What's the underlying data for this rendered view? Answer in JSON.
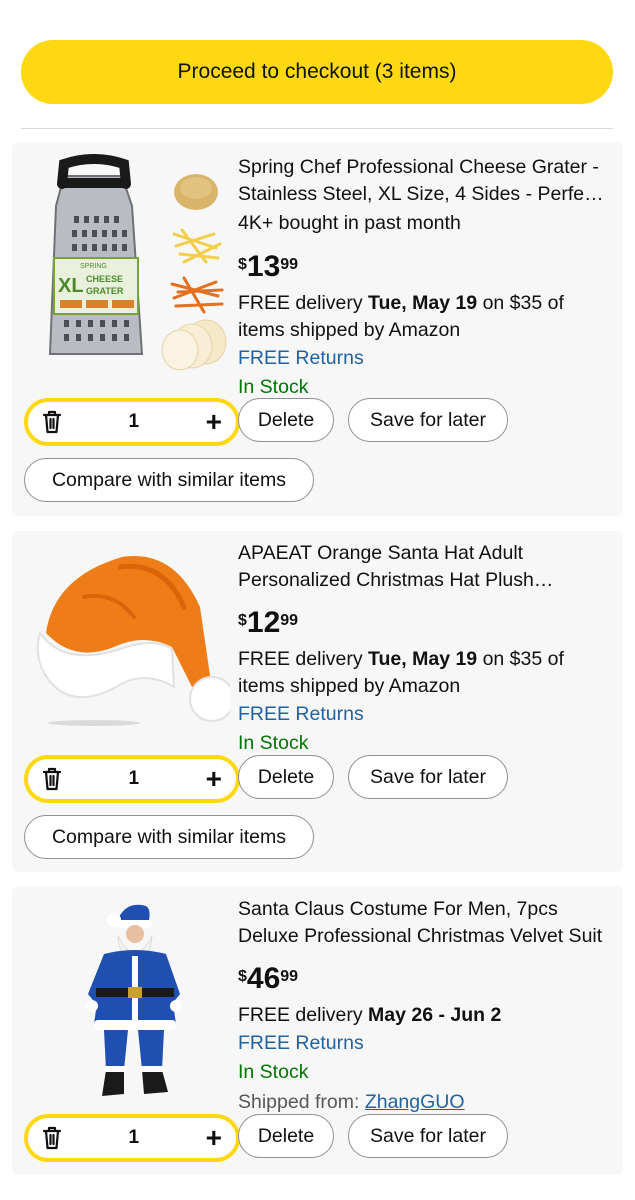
{
  "checkout": {
    "label": "Proceed to checkout (3 items)"
  },
  "items": [
    {
      "title": "Spring Chef Professional Cheese Grater - Stainless Steel, XL Size, 4 Sides - Perfect Box Grater for Parmesan Cheese, Vegetables, Ginger",
      "bought": "4K+ bought in past month",
      "price_symbol": "$",
      "price_whole": "13",
      "price_fraction": "99",
      "delivery_prefix": "FREE delivery ",
      "delivery_date": "Tue, May 19",
      "delivery_suffix": " on $35 of items shipped by Amazon",
      "returns": "FREE Returns",
      "stock": "In Stock",
      "quantity": "1",
      "delete_label": "Delete",
      "save_label": "Save for later",
      "compare_label": "Compare with similar items",
      "image_text": {
        "brand": "SPRING",
        "size": "XL",
        "line1": "CHEESE",
        "line2": "GRATER"
      }
    },
    {
      "title": "APAEAT Orange Santa Hat Adult Personalized Christmas Hat Plush Comfortable Xmas Hat",
      "price_symbol": "$",
      "price_whole": "12",
      "price_fraction": "99",
      "delivery_prefix": "FREE delivery ",
      "delivery_date": "Tue, May 19",
      "delivery_suffix": " on $35 of items shipped by Amazon",
      "returns": "FREE Returns",
      "stock": "In Stock",
      "quantity": "1",
      "delete_label": "Delete",
      "save_label": "Save for later",
      "compare_label": "Compare with similar items"
    },
    {
      "title": "Santa Claus Costume For Men, 7pcs Deluxe Professional Christmas Velvet Suit",
      "price_symbol": "$",
      "price_whole": "46",
      "price_fraction": "99",
      "delivery_prefix": "FREE delivery ",
      "delivery_date": "May 26 - Jun 2",
      "returns": "FREE Returns",
      "stock": "In Stock",
      "shipped_from_label": "Shipped from: ",
      "shipped_from_seller": "ZhangGUO",
      "quantity": "1",
      "delete_label": "Delete",
      "save_label": "Save for later"
    }
  ],
  "colors": {
    "checkout_bg": "#ffd814",
    "stepper_border": "#ffd814",
    "link": "#2162a1",
    "in_stock": "#007600",
    "card_bg": "#f7f7f7"
  },
  "icons": {
    "trash": "trash-icon",
    "plus": "plus-icon"
  }
}
